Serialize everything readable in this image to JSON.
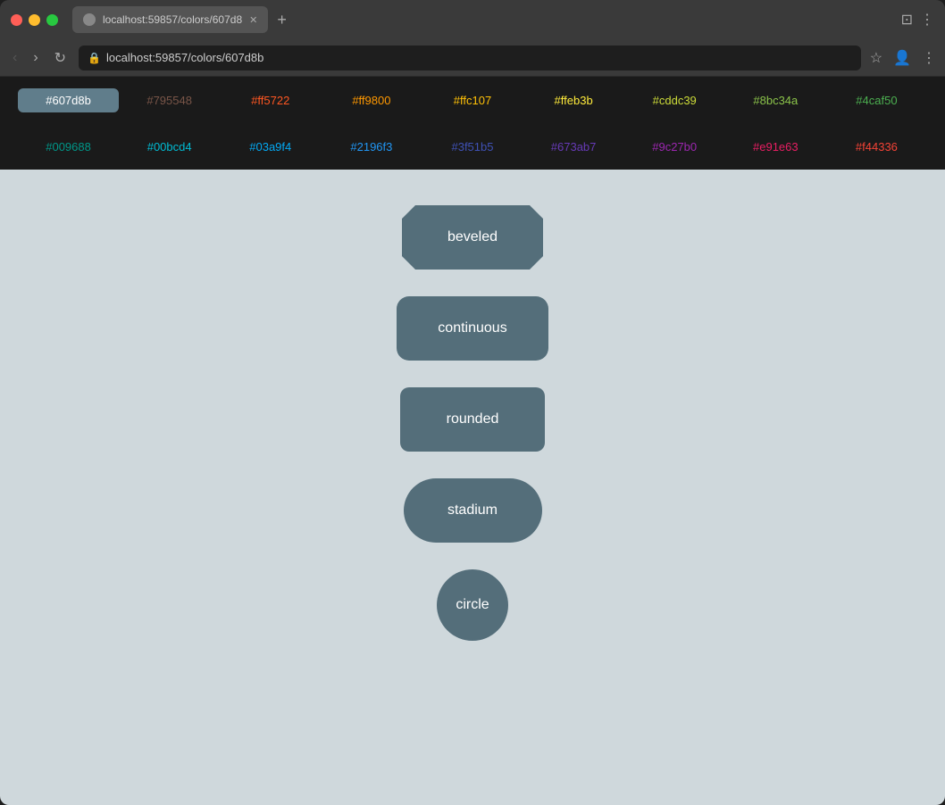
{
  "browser": {
    "url": "localhost:59857/colors/607d8b",
    "tab_label": "localhost:59857/colors/607d8"
  },
  "palette": {
    "row1": [
      {
        "hex": "#607d8b",
        "label": "#607d8b",
        "selected": true,
        "color": "#fff"
      },
      {
        "hex": "#795548",
        "label": "#795548",
        "selected": false,
        "color": "#795548"
      },
      {
        "hex": "#ff5722",
        "label": "#ff5722",
        "selected": false,
        "color": "#ff5722"
      },
      {
        "hex": "#ff9800",
        "label": "#ff9800",
        "selected": false,
        "color": "#ff9800"
      },
      {
        "hex": "#ffc107",
        "label": "#ffc107",
        "selected": false,
        "color": "#ffc107"
      },
      {
        "hex": "#ffeb3b",
        "label": "#ffeb3b",
        "selected": false,
        "color": "#ffeb3b"
      },
      {
        "hex": "#cddc39",
        "label": "#cddc39",
        "selected": false,
        "color": "#cddc39"
      },
      {
        "hex": "#8bc34a",
        "label": "#8bc34a",
        "selected": false,
        "color": "#8bc34a"
      },
      {
        "hex": "#4caf50",
        "label": "#4caf50",
        "selected": false,
        "color": "#4caf50"
      }
    ],
    "row2": [
      {
        "hex": "#009688",
        "label": "#009688",
        "selected": false,
        "color": "#009688"
      },
      {
        "hex": "#00bcd4",
        "label": "#00bcd4",
        "selected": false,
        "color": "#00bcd4"
      },
      {
        "hex": "#03a9f4",
        "label": "#03a9f4",
        "selected": false,
        "color": "#03a9f4"
      },
      {
        "hex": "#2196f3",
        "label": "#2196f3",
        "selected": false,
        "color": "#2196f3"
      },
      {
        "hex": "#3f51b5",
        "label": "#3f51b5",
        "selected": false,
        "color": "#3f51b5"
      },
      {
        "hex": "#673ab7",
        "label": "#673ab7",
        "selected": false,
        "color": "#673ab7"
      },
      {
        "hex": "#9c27b0",
        "label": "#9c27b0",
        "selected": false,
        "color": "#9c27b0"
      },
      {
        "hex": "#e91e63",
        "label": "#e91e63",
        "selected": false,
        "color": "#e91e63"
      },
      {
        "hex": "#f44336",
        "label": "#f44336",
        "selected": false,
        "color": "#f44336"
      }
    ]
  },
  "shapes": [
    {
      "id": "beveled",
      "label": "beveled",
      "shape_class": "beveled"
    },
    {
      "id": "continuous",
      "label": "continuous",
      "shape_class": "continuous"
    },
    {
      "id": "rounded",
      "label": "rounded",
      "shape_class": "rounded"
    },
    {
      "id": "stadium",
      "label": "stadium",
      "shape_class": "stadium"
    },
    {
      "id": "circle",
      "label": "circle",
      "shape_class": "circle"
    }
  ],
  "nav": {
    "back_label": "‹",
    "forward_label": "›",
    "reload_label": "↻"
  }
}
